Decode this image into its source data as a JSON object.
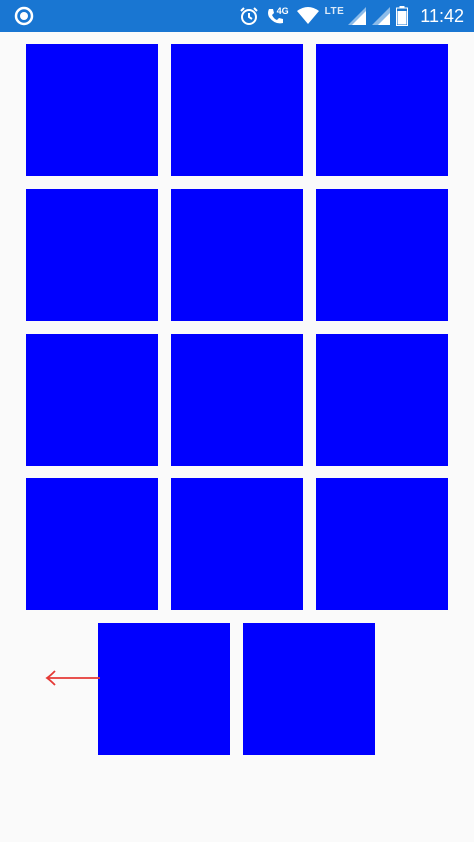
{
  "status_bar": {
    "time": "11:42",
    "network_type": "4G",
    "network_label": "LTE",
    "background_color": "#1976d2",
    "icons": [
      "circle-app-icon",
      "alarm-icon",
      "call-4g-icon",
      "wifi-icon",
      "signal-icon",
      "signal-icon",
      "battery-icon"
    ]
  },
  "grid": {
    "tile_color": "#0000ff",
    "rows": [
      3,
      3,
      3,
      3,
      2
    ],
    "tile_count": 14
  },
  "arrow": {
    "icon": "arrow-left-icon",
    "color": "#e53935"
  }
}
